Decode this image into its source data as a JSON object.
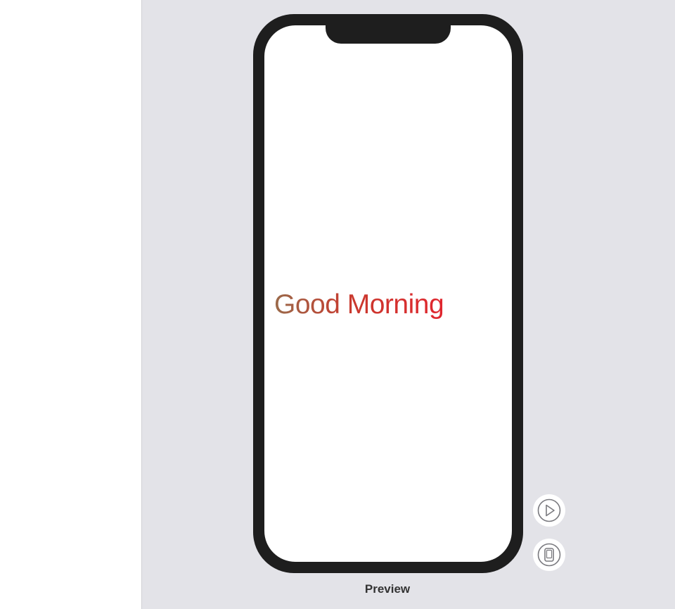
{
  "preview": {
    "greeting_text": "Good Morning",
    "label": "Preview"
  },
  "controls": {
    "live_preview_icon": "play-circle-icon",
    "device_settings_icon": "device-icon"
  },
  "colors": {
    "canvas_background": "#e3e3e8",
    "device_frame": "#1e1e1e",
    "greeting_gradient_start": "#9a6a4a",
    "greeting_gradient_end": "#e0262e"
  }
}
